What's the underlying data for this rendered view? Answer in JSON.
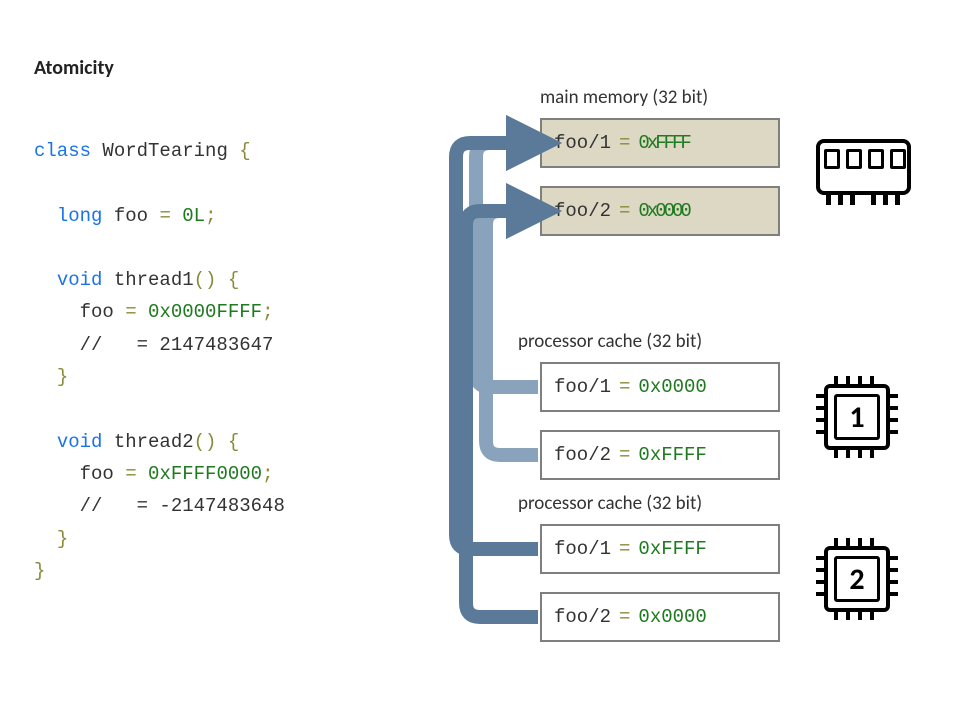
{
  "title": "Atomicity",
  "code": {
    "class_kw": "class",
    "class_name": "WordTearing",
    "field_type": "long",
    "field_name": "foo",
    "field_init": "0L",
    "void_kw": "void",
    "thread1_name": "thread1",
    "thread1_assign_lhs": "foo",
    "thread1_assign_rhs": "0x0000FFFF",
    "thread1_comment": "//   = 2147483647",
    "thread2_name": "thread2",
    "thread2_assign_lhs": "foo",
    "thread2_assign_rhs": "0xFFFF0000",
    "thread2_comment": "//   = -2147483648"
  },
  "labels": {
    "main_memory": "main memory (32 bit)",
    "cache1": "processor cache (32 bit)",
    "cache2": "processor cache (32 bit)"
  },
  "memory": {
    "row1_label": "foo/1",
    "row1_val": "0xFFFF",
    "row2_label": "foo/2",
    "row2_val": "0x0000"
  },
  "cache1": {
    "row1_label": "foo/1",
    "row1_val": "0x0000",
    "row2_label": "foo/2",
    "row2_val": "0xFFFF"
  },
  "cache2": {
    "row1_label": "foo/1",
    "row1_val": "0xFFFF",
    "row2_label": "foo/2",
    "row2_val": "0x0000"
  },
  "cpu": {
    "one": "1",
    "two": "2"
  }
}
